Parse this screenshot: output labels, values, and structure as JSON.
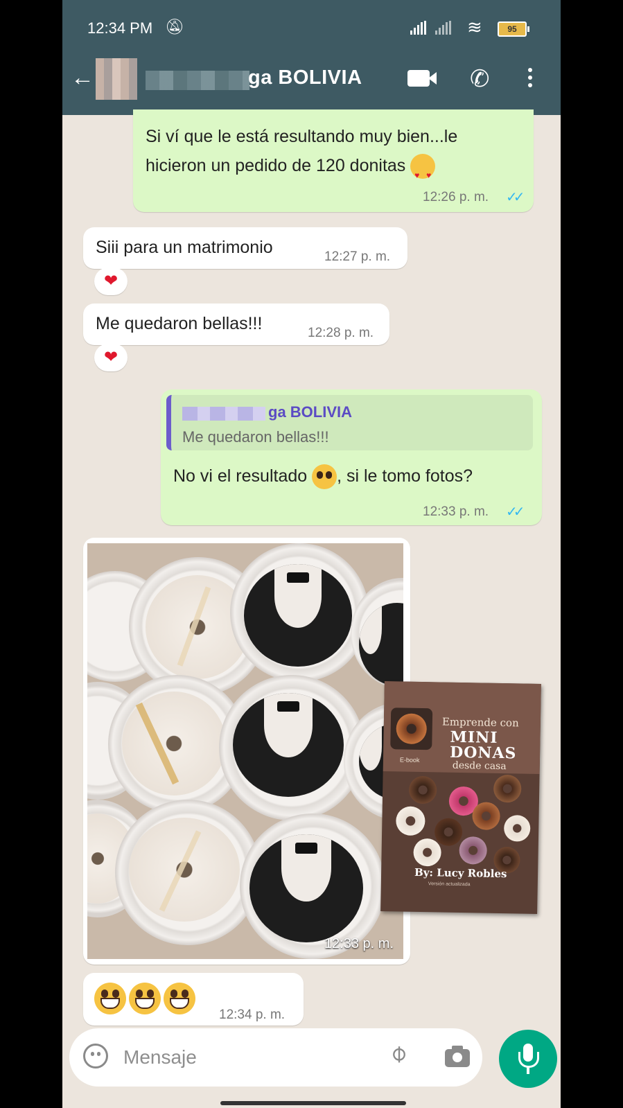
{
  "status_bar": {
    "time": "12:34 PM",
    "battery": "95"
  },
  "header": {
    "title": "ga BOLIVIA"
  },
  "messages": {
    "m1": {
      "text": "Si ví que le está resultando muy bien...le hicieron un pedido de 120 donitas",
      "time": "12:26 p. m.",
      "ticks": "✓✓"
    },
    "m2": {
      "text": "Siii para un matrimonio",
      "time": "12:27 p. m.",
      "reaction": "❤"
    },
    "m3": {
      "text": "Me quedaron bellas!!!",
      "time": "12:28 p. m.",
      "reaction": "❤"
    },
    "m4": {
      "quote_name": "ga BOLIVIA",
      "quote_text": "Me quedaron bellas!!!",
      "text_before": "No vi el resultado ",
      "text_after": ", si le tomo fotos?",
      "time": "12:33 p. m.",
      "ticks": "✓✓"
    },
    "m5": {
      "time": "12:33 p. m."
    },
    "m6": {
      "time": "12:34 p. m."
    }
  },
  "ebook": {
    "line1": "Emprende con",
    "mini": "MINI",
    "donas": "DONAS",
    "desde": "desde casa",
    "tag": "E-book",
    "author": "By: Lucy Robles",
    "version": "Versión actualizada"
  },
  "input": {
    "placeholder": "Mensaje"
  },
  "icons": {
    "back": "arrow-left-icon",
    "video": "video-call-icon",
    "call": "phone-icon",
    "menu": "kebab-menu-icon",
    "emoji": "emoji-icon",
    "attach": "paperclip-icon",
    "camera": "camera-icon",
    "mic": "mic-icon"
  },
  "colors": {
    "header": "#3e5a63",
    "outgoing": "#dcf8c6",
    "incoming": "#ffffff",
    "chat_bg": "#ece5dd",
    "read_ticks": "#34b7f1",
    "mic_button": "#00a884"
  }
}
